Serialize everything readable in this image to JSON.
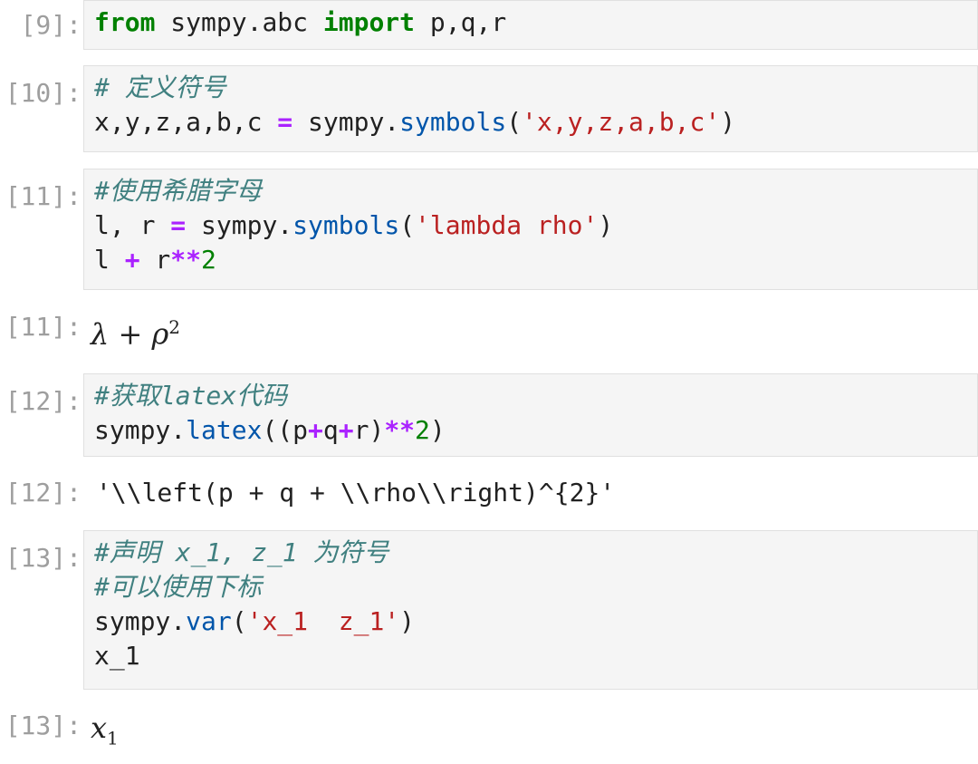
{
  "cells": [
    {
      "in_prompt": "[9]:",
      "lines": [
        [
          "from",
          " sympy.abc ",
          "import",
          " p,q,r"
        ]
      ]
    },
    {
      "in_prompt": "[10]:",
      "lines": [
        [
          "# 定义符号"
        ],
        [
          "x,y,z,a,b,c ",
          "=",
          " sympy.",
          "symbols",
          "(",
          "'x,y,z,a,b,c'",
          ")"
        ]
      ]
    },
    {
      "in_prompt": "[11]:",
      "lines": [
        [
          "#使用希腊字母"
        ],
        [
          "l, r ",
          "=",
          " sympy.",
          "symbols",
          "(",
          "'lambda rho'",
          ")"
        ],
        [
          "l ",
          "+",
          " r",
          "**",
          "2"
        ]
      ],
      "out_prompt": "[11]:",
      "out_base1": "λ",
      "out_op": " + ",
      "out_base2": "ρ",
      "out_sup": "2"
    },
    {
      "in_prompt": "[12]:",
      "lines": [
        [
          "#获取latex代码"
        ],
        [
          "sympy.",
          "latex",
          "((p",
          "+",
          "q",
          "+",
          "r)",
          "**",
          "2",
          ")"
        ]
      ],
      "out_prompt": "[12]:",
      "out_text": "'\\\\left(p + q + \\\\rho\\\\right)^{2}'"
    },
    {
      "in_prompt": "[13]:",
      "lines": [
        [
          "#声明 x_1, z_1 为符号"
        ],
        [
          "#可以使用下标"
        ],
        [
          "sympy.",
          "var",
          "(",
          "'x_1  z_1'",
          ")"
        ],
        [
          "x_1"
        ]
      ],
      "out_prompt": "[13]:",
      "out_base": "x",
      "out_sub": "1"
    }
  ]
}
